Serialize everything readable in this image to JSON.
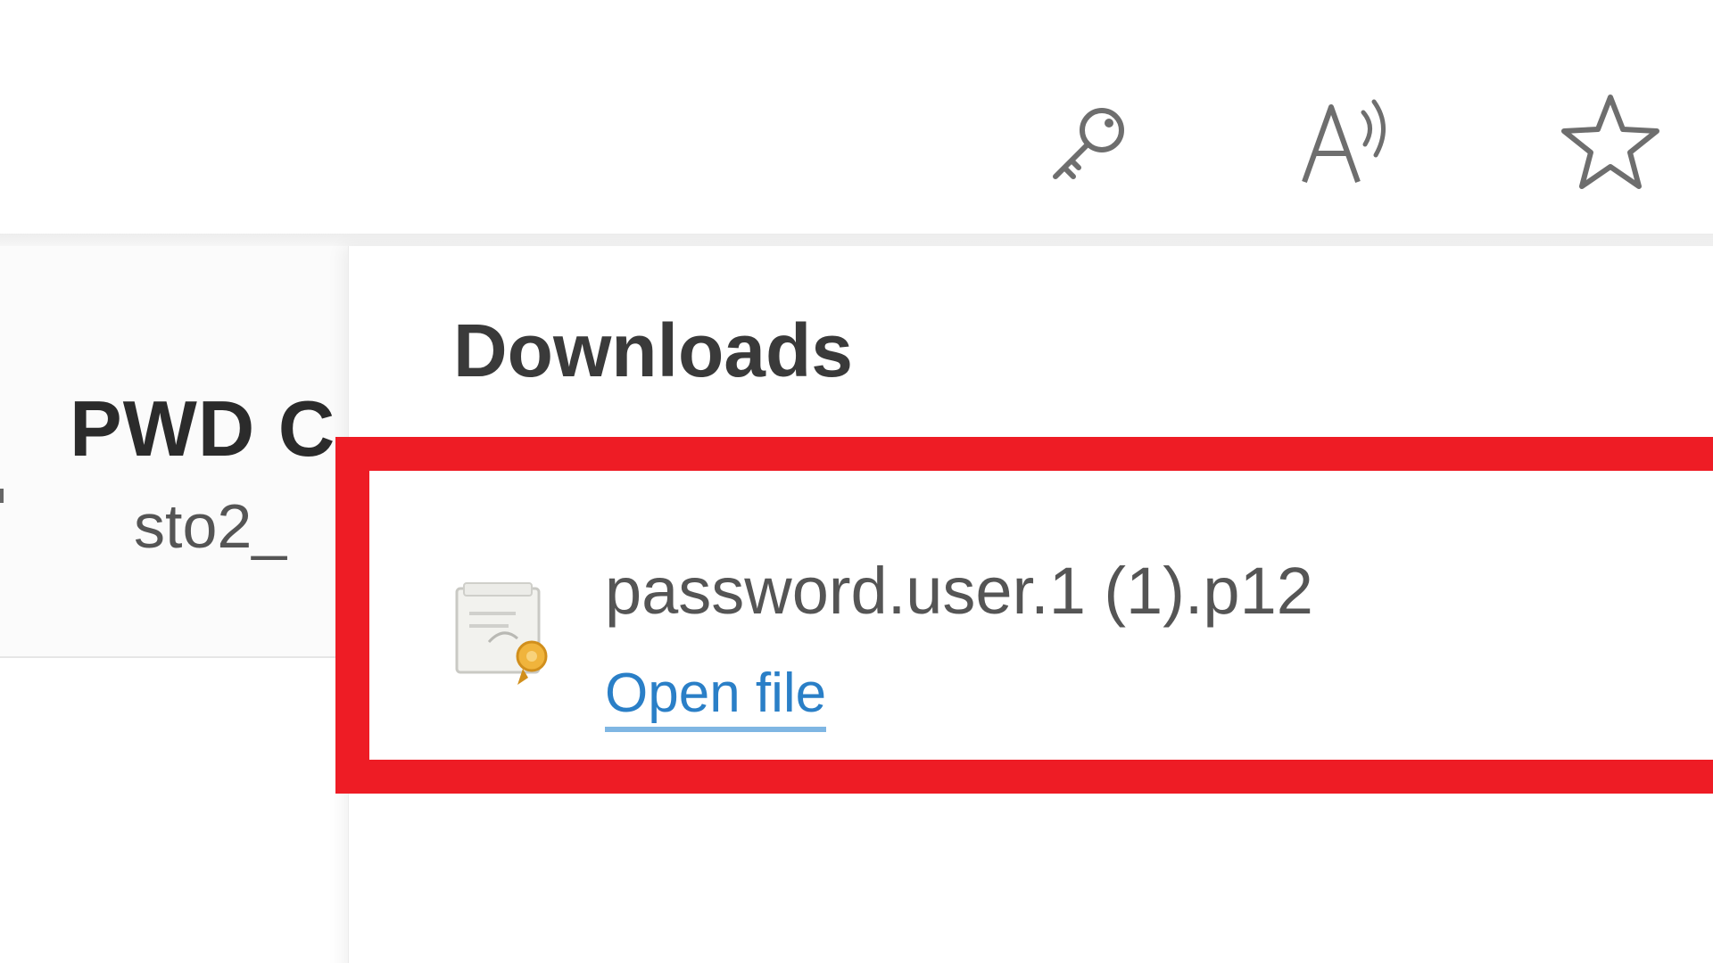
{
  "toolbar": {
    "icons": {
      "passwords": "key-icon",
      "read_aloud": "read-aloud-icon",
      "favorites": "star-icon"
    }
  },
  "page": {
    "card_title": "PWD C",
    "card_subtitle": "sto2_"
  },
  "downloads": {
    "title": "Downloads",
    "items": [
      {
        "file_name": "password.user.1 (1).p12",
        "action_label": "Open file",
        "icon": "certificate-file-icon"
      }
    ]
  },
  "colors": {
    "highlight": "#ee1c25",
    "link": "#2a7fc7"
  }
}
